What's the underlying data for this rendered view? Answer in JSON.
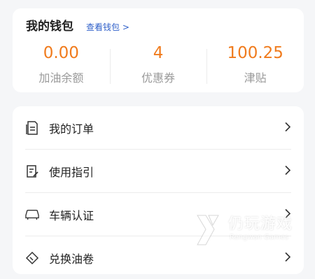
{
  "wallet": {
    "title": "我的钱包",
    "link": "查看钱包 >",
    "stats": [
      {
        "value": "0.00",
        "label": "加油余额"
      },
      {
        "value": "4",
        "label": "优惠券"
      },
      {
        "value": "100.25",
        "label": "津贴"
      }
    ]
  },
  "menu": {
    "items": [
      {
        "label": "我的订单",
        "icon": "order-icon"
      },
      {
        "label": "使用指引",
        "icon": "guide-icon"
      },
      {
        "label": "车辆认证",
        "icon": "car-icon"
      },
      {
        "label": "兑换油卷",
        "icon": "ticket-icon"
      }
    ]
  },
  "watermark": {
    "cn": "仍玩游戏",
    "en": "Rengwan Games"
  },
  "colors": {
    "accent": "#f07b1d",
    "link": "#2e5fc9",
    "background": "#f5f6f8"
  }
}
